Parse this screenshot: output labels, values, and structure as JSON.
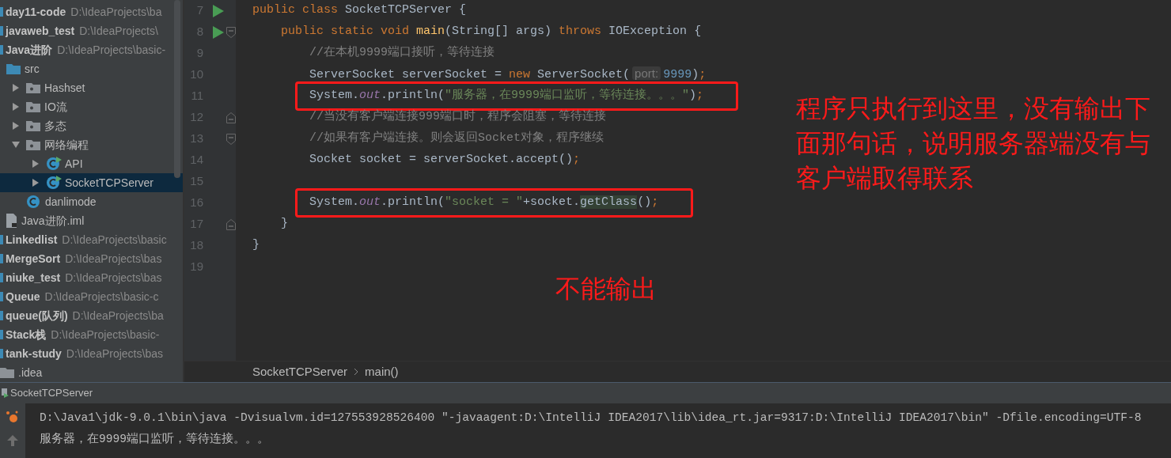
{
  "project_tree": [
    {
      "kind": "module",
      "label": "day11-code",
      "path": "D:\\IdeaProjects\\ba",
      "selected": false
    },
    {
      "kind": "module",
      "label": "javaweb_test",
      "path": "D:\\IdeaProjects\\",
      "selected": false
    },
    {
      "kind": "module",
      "label": "Java进阶",
      "path": "D:\\IdeaProjects\\basic-",
      "selected": false,
      "children": [
        {
          "kind": "source-folder",
          "label": "src",
          "selected": false,
          "children": [
            {
              "kind": "package",
              "label": "Hashset",
              "expanded": false,
              "selected": false
            },
            {
              "kind": "package",
              "label": "IO流",
              "expanded": false,
              "selected": false
            },
            {
              "kind": "package",
              "label": "多态",
              "expanded": false,
              "selected": false
            },
            {
              "kind": "package",
              "label": "网络编程",
              "expanded": true,
              "selected": false,
              "children": [
                {
                  "kind": "class",
                  "label": "API",
                  "expanded": false,
                  "runnable": true,
                  "selected": false
                },
                {
                  "kind": "class",
                  "label": "SocketTCPServer",
                  "expanded": false,
                  "runnable": true,
                  "selected": true
                }
              ]
            },
            {
              "kind": "class",
              "label": "danlimode",
              "runnable": false,
              "selected": false
            }
          ]
        },
        {
          "kind": "file",
          "label": "Java进阶.iml",
          "selected": false
        }
      ]
    },
    {
      "kind": "module",
      "label": "Linkedlist",
      "path": "D:\\IdeaProjects\\basic",
      "selected": false
    },
    {
      "kind": "module",
      "label": "MergeSort",
      "path": "D:\\IdeaProjects\\bas",
      "selected": false
    },
    {
      "kind": "module",
      "label": "niuke_test",
      "path": "D:\\IdeaProjects\\bas",
      "selected": false
    },
    {
      "kind": "module",
      "label": "Queue",
      "path": "D:\\IdeaProjects\\basic-c",
      "selected": false
    },
    {
      "kind": "module",
      "label": "queue(队列)",
      "path": "D:\\IdeaProjects\\ba",
      "selected": false
    },
    {
      "kind": "module",
      "label": "Stack栈",
      "path": "D:\\IdeaProjects\\basic-",
      "selected": false
    },
    {
      "kind": "module",
      "label": "tank-study",
      "path": "D:\\IdeaProjects\\bas",
      "selected": false
    },
    {
      "kind": "folder",
      "label": ".idea",
      "selected": false
    }
  ],
  "editor": {
    "lines": [
      {
        "number": "7",
        "run": true,
        "fold_open": false,
        "fold_close": false,
        "boxed": false,
        "tokens": [
          {
            "kind": "keyword",
            "text": "public class "
          },
          {
            "kind": "plain",
            "text": "SocketTCPServer {"
          }
        ]
      },
      {
        "number": "8",
        "run": true,
        "fold_open": true,
        "fold_close": false,
        "boxed": false,
        "tokens": [
          {
            "kind": "keyword",
            "text": "    public static void "
          },
          {
            "kind": "method",
            "text": "main"
          },
          {
            "kind": "plain",
            "text": "(String[] args) "
          },
          {
            "kind": "keyword",
            "text": "throws "
          },
          {
            "kind": "plain",
            "text": "IOException {"
          }
        ]
      },
      {
        "number": "9",
        "run": false,
        "fold_open": false,
        "fold_close": false,
        "boxed": false,
        "tokens": [
          {
            "kind": "comment",
            "text": "        //在本机9999端口接听，等待连接"
          }
        ]
      },
      {
        "number": "10",
        "run": false,
        "fold_open": false,
        "fold_close": false,
        "boxed": false,
        "tokens": [
          {
            "kind": "plain",
            "text": "        ServerSocket serverSocket = "
          },
          {
            "kind": "keyword",
            "text": "new "
          },
          {
            "kind": "plain",
            "text": "ServerSocket("
          },
          {
            "kind": "hint",
            "text": "port:"
          },
          {
            "kind": "number",
            "text": "9999"
          },
          {
            "kind": "plain",
            "text": ")"
          },
          {
            "kind": "keyword",
            "text": ";"
          }
        ]
      },
      {
        "number": "11",
        "run": false,
        "fold_open": false,
        "fold_close": false,
        "boxed": true,
        "tokens": [
          {
            "kind": "plain",
            "text": "        System."
          },
          {
            "kind": "field",
            "text": "out"
          },
          {
            "kind": "plain",
            "text": ".println("
          },
          {
            "kind": "string",
            "text": "\"服务器，在9999端口监听，等待连接。。。\""
          },
          {
            "kind": "plain",
            "text": ")"
          },
          {
            "kind": "keyword",
            "text": ";"
          }
        ]
      },
      {
        "number": "12",
        "run": false,
        "fold_open": false,
        "fold_close": true,
        "boxed": false,
        "tokens": [
          {
            "kind": "comment",
            "text": "        //当没有客户端连接999端口时，程序会阻塞，等待连接"
          }
        ]
      },
      {
        "number": "13",
        "run": false,
        "fold_open": true,
        "fold_close": false,
        "boxed": false,
        "tokens": [
          {
            "kind": "comment",
            "text": "        //如果有客户端连接。则会返回Socket对象，程序继续"
          }
        ]
      },
      {
        "number": "14",
        "run": false,
        "fold_open": false,
        "fold_close": false,
        "boxed": false,
        "tokens": [
          {
            "kind": "plain",
            "text": "        Socket socket = serverSocket.accept()"
          },
          {
            "kind": "keyword",
            "text": ";"
          }
        ]
      },
      {
        "number": "15",
        "run": false,
        "fold_open": false,
        "fold_close": false,
        "boxed": false
      },
      {
        "number": "16",
        "run": false,
        "fold_open": false,
        "fold_close": false,
        "boxed": true,
        "tokens": [
          {
            "kind": "plain",
            "text": "        System."
          },
          {
            "kind": "field",
            "text": "out"
          },
          {
            "kind": "plain",
            "text": ".println("
          },
          {
            "kind": "string",
            "text": "\"socket = \""
          },
          {
            "kind": "plain",
            "text": "+socket."
          },
          {
            "kind": "usage",
            "text": "getClass"
          },
          {
            "kind": "plain",
            "text": "()"
          },
          {
            "kind": "keyword",
            "text": ";"
          }
        ]
      },
      {
        "number": "17",
        "run": false,
        "fold_open": false,
        "fold_close": true,
        "boxed": false,
        "tokens": [
          {
            "kind": "plain",
            "text": "    }"
          }
        ]
      },
      {
        "number": "18",
        "run": false,
        "fold_open": false,
        "fold_close": false,
        "boxed": false,
        "tokens": [
          {
            "kind": "plain",
            "text": "}"
          }
        ]
      },
      {
        "number": "19",
        "run": false,
        "fold_open": false,
        "fold_close": false,
        "boxed": false
      }
    ],
    "breadcrumbs": [
      "SocketTCPServer",
      "main()"
    ]
  },
  "annotations": [
    {
      "kind": "side-note",
      "text": "程序只执行到这里，没有输出下面那句话，说明服务器端没有与客户端取得联系"
    },
    {
      "kind": "below-note",
      "text": "不能输出"
    }
  ],
  "run_panel": {
    "tab": "SocketTCPServer",
    "console": [
      "D:\\Java1\\jdk-9.0.1\\bin\\java -Dvisualvm.id=127553928526400 \"-javaagent:D:\\IntelliJ IDEA2017\\lib\\idea_rt.jar=9317:D:\\IntelliJ IDEA2017\\bin\" -Dfile.encoding=UTF-8",
      "服务器，在9999端口监听，等待连接。。。"
    ]
  }
}
